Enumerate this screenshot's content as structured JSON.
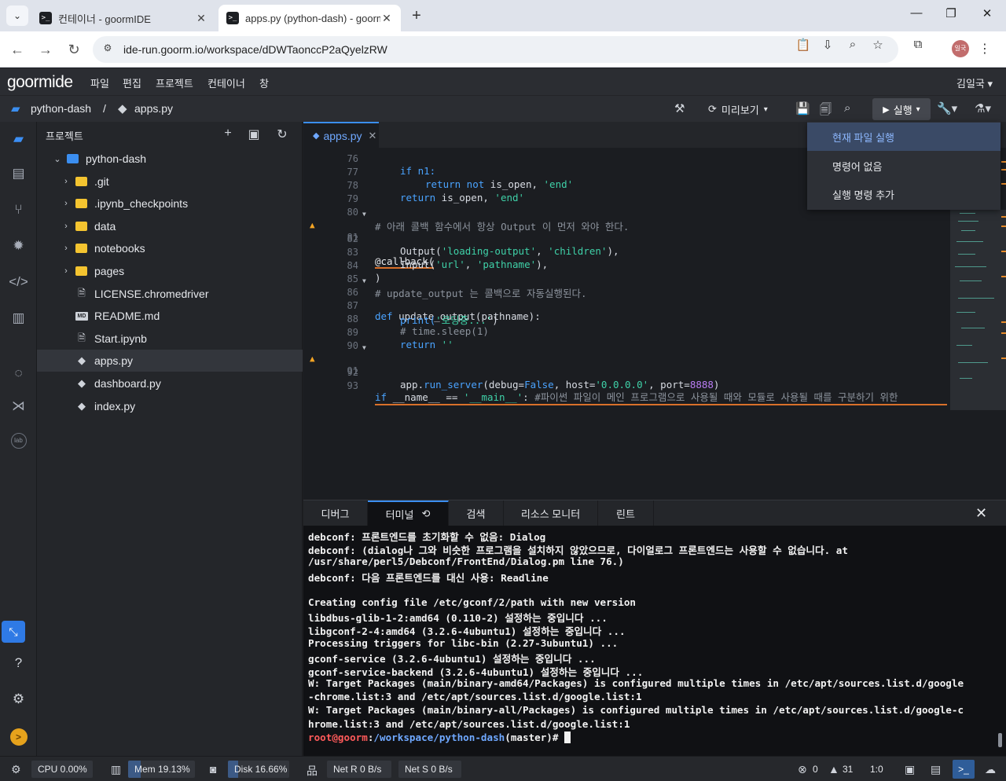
{
  "browser": {
    "tabs": [
      {
        "title": "컨테이너 - goormIDE",
        "active": false
      },
      {
        "title": "apps.py (python-dash) - goorm",
        "active": true
      }
    ],
    "url": "ide-run.goorm.io/workspace/dDWTaonccP2aQyelzRW",
    "profile_initials": "일국"
  },
  "app": {
    "logo": "goormide",
    "menu": [
      "파일",
      "편집",
      "프로젝트",
      "컨테이너",
      "창"
    ],
    "user": "김일국"
  },
  "toolbar": {
    "project": "python-dash",
    "separator": "/",
    "file": "apps.py",
    "preview_label": "미리보기",
    "run_label": "실행"
  },
  "run_menu": {
    "items": [
      "현재 파일 실행",
      "명령어 없음",
      "실행 명령 추가"
    ],
    "highlighted_index": 0
  },
  "explorer": {
    "title": "프로젝트",
    "root": "python-dash",
    "folders": [
      ".git",
      ".ipynb_checkpoints",
      "data",
      "notebooks",
      "pages"
    ],
    "files": [
      {
        "name": "LICENSE.chromedriver",
        "icon": "file-icon"
      },
      {
        "name": "README.md",
        "icon": "markdown-icon"
      },
      {
        "name": "Start.ipynb",
        "icon": "file-icon"
      },
      {
        "name": "apps.py",
        "icon": "python-icon",
        "selected": true
      },
      {
        "name": "dashboard.py",
        "icon": "python-icon"
      },
      {
        "name": "index.py",
        "icon": "python-icon"
      }
    ]
  },
  "editor": {
    "tab": "apps.py",
    "line_numbers": [
      "76",
      "77",
      "78",
      "79",
      "80",
      "81",
      "82",
      "83",
      "84",
      "85",
      "86",
      "87",
      "88",
      "89",
      "90",
      "91",
      "92",
      "93"
    ],
    "lines": {
      "l76": "if n1:",
      "l77a": "return not",
      "l77b": " is_open, ",
      "l77c": "'end'",
      "l78a": "return",
      "l78b": " is_open, ",
      "l78c": "'end'",
      "l80": "# 아래 콜백 함수에서 항상 Output 이 먼저 와야 한다.",
      "l81": "@callback(",
      "l82a": "Output(",
      "l82b": "'loading-output'",
      "l82c": ", ",
      "l82d": "'children'",
      "l82e": "),",
      "l83a": "Input(",
      "l83b": "'url'",
      "l83c": ", ",
      "l83d": "'pathname'",
      "l83e": "),",
      "l84": ")",
      "l85": "# update_output 는 콜백으로 자동실행된다.",
      "l86a": "def",
      "l86b": " update_output(pathname):",
      "l87a": "print(",
      "l87b": "'로딩중...'",
      "l87c": ")",
      "l88": "# time.sleep(1)",
      "l89a": "return",
      "l89b": " ''",
      "l91a": "if",
      "l91b": " __name__ == ",
      "l91c": "'__main__'",
      "l91d": ": ",
      "l91e": "#파이썬 파일이 메인 프로그램으로 사용될 때와 모듈로 사용될 때를 구분하기 위한",
      "l92a": "app.",
      "l92b": "run_server",
      "l92c": "(debug=",
      "l92d": "False",
      "l92e": ", host=",
      "l92f": "'0.0.0.0'",
      "l92g": ", port=",
      "l92h": "8888",
      "l92i": ")"
    }
  },
  "panel": {
    "tabs": [
      "디버그",
      "터미널",
      "검색",
      "리소스 모니터",
      "린트"
    ],
    "active_tab": "터미널",
    "terminal_lines": [
      "debconf: 프론트엔드를 초기화할 수 없음: Dialog",
      "debconf: (dialog나 그와 비슷한 프로그램을 설치하지 않았으므로, 다이얼로그 프론트엔드는 사용할 수 없습니다. at",
      "/usr/share/perl5/Debconf/FrontEnd/Dialog.pm line 76.)",
      "debconf: 다음 프론트엔드를 대신 사용: Readline",
      "",
      "Creating config file /etc/gconf/2/path with new version",
      "libdbus-glib-1-2:amd64 (0.110-2) 설정하는 중입니다 ...",
      "libgconf-2-4:amd64 (3.2.6-4ubuntu1) 설정하는 중입니다 ...",
      "Processing triggers for libc-bin (2.27-3ubuntu1) ...",
      "gconf-service (3.2.6-4ubuntu1) 설정하는 중입니다 ...",
      "gconf-service-backend (3.2.6-4ubuntu1) 설정하는 중입니다 ...",
      "W: Target Packages (main/binary-amd64/Packages) is configured multiple times in /etc/apt/sources.list.d/google",
      "-chrome.list:3 and /etc/apt/sources.list.d/google.list:1",
      "W: Target Packages (main/binary-all/Packages) is configured multiple times in /etc/apt/sources.list.d/google-c",
      "hrome.list:3 and /etc/apt/sources.list.d/google.list:1"
    ],
    "prompt_user": "root@goorm",
    "prompt_colon": ":",
    "prompt_path": "/workspace/python-dash",
    "prompt_rest": "(master)# "
  },
  "status": {
    "cpu": "CPU 0.00%",
    "cpu_pct": 0.0,
    "mem": "Mem 19.13%",
    "mem_pct": 19.13,
    "disk": "Disk 16.66%",
    "disk_pct": 16.66,
    "net_r": "Net R 0 B/s",
    "net_s": "Net S 0 B/s",
    "errors": "0",
    "warnings": "31",
    "position": "1:0"
  },
  "colors": {
    "accent": "#3b8ef0",
    "keyword": "#4aa3ff",
    "string": "#3fd1a8",
    "warning": "#f5a524"
  }
}
